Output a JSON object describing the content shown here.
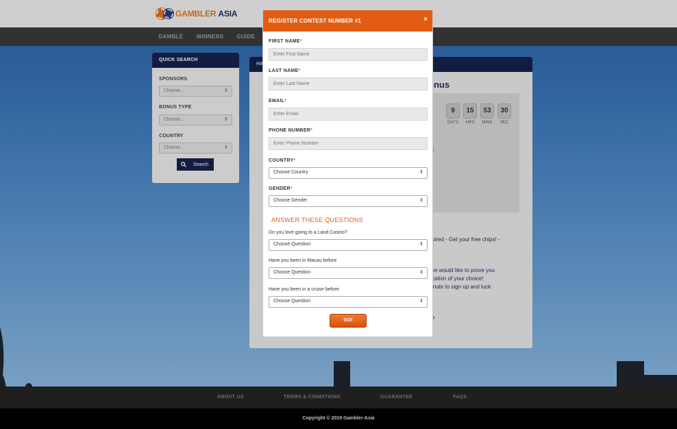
{
  "header": {
    "logo_text_orange": "GAMBLER",
    "logo_text_dark": "ASIA"
  },
  "nav": {
    "items": [
      "GAMBLE",
      "WINNERS",
      "GUIDE"
    ]
  },
  "quick_search": {
    "title": "QUICK SEARCH",
    "sponsors_label": "SPONSORS",
    "sponsors_value": "Choose...",
    "bonus_type_label": "BONUS TYPE",
    "bonus_type_value": "Choose...",
    "country_label": "COUNTRY",
    "country_value": "Choose...",
    "search_button": "Search"
  },
  "background_panel": {
    "header_fragment": "HA",
    "title_fragment": "onus",
    "countdown": {
      "days": "9",
      "hrs": "15",
      "mins": "53",
      "sec": "30",
      "days_label": "DAYS",
      "hrs_label": "HRS",
      "mins_label": "MINS",
      "sec_label": "SEC"
    },
    "big_fragment": ")",
    "line1": "uired - Get your free chips! -",
    "line2": "ve would like to prove you",
    "line3": "cation of your choice!",
    "line4": "inute to sign up and luck",
    "line5": "e"
  },
  "modal": {
    "title": "REGISTER CONTEST NUMBER #1",
    "close_glyph": "×",
    "required_mark": "*",
    "first_name_label": "FIRST NAME",
    "first_name_placeholder": "Enter First Name",
    "last_name_label": "LAST NAME",
    "last_name_placeholder": "Enter Last Name",
    "email_label": "EMAIL",
    "email_placeholder": "Enter Email",
    "phone_label": "PHONE NUMBER",
    "phone_placeholder": "Enter Phone Number",
    "country_label": "COUNTRY",
    "country_value": "Choose Country",
    "gender_label": "GENDER",
    "gender_value": "Choose Gender",
    "questions_title": "ANSWER THESE QUESTIONS",
    "q1": "Do you love going to a Land Casino?",
    "q1_value": "Choose Question",
    "q2": "Have you been in Macau before",
    "q2_value": "Choose Question",
    "q3": "Have you been in a cruise before",
    "q3_value": "Choose Question",
    "go_button": "GO!"
  },
  "footer": {
    "links": [
      "ABOUT US",
      "TERMS & CONDITIONS",
      "GUARANTEE",
      "FAQS"
    ],
    "copyright": "Copyright © 2019 Gambler-Asia"
  },
  "colors": {
    "accent_orange": "#e25c13",
    "navy": "#15224a",
    "nav_bar": "#3a3a3a"
  }
}
